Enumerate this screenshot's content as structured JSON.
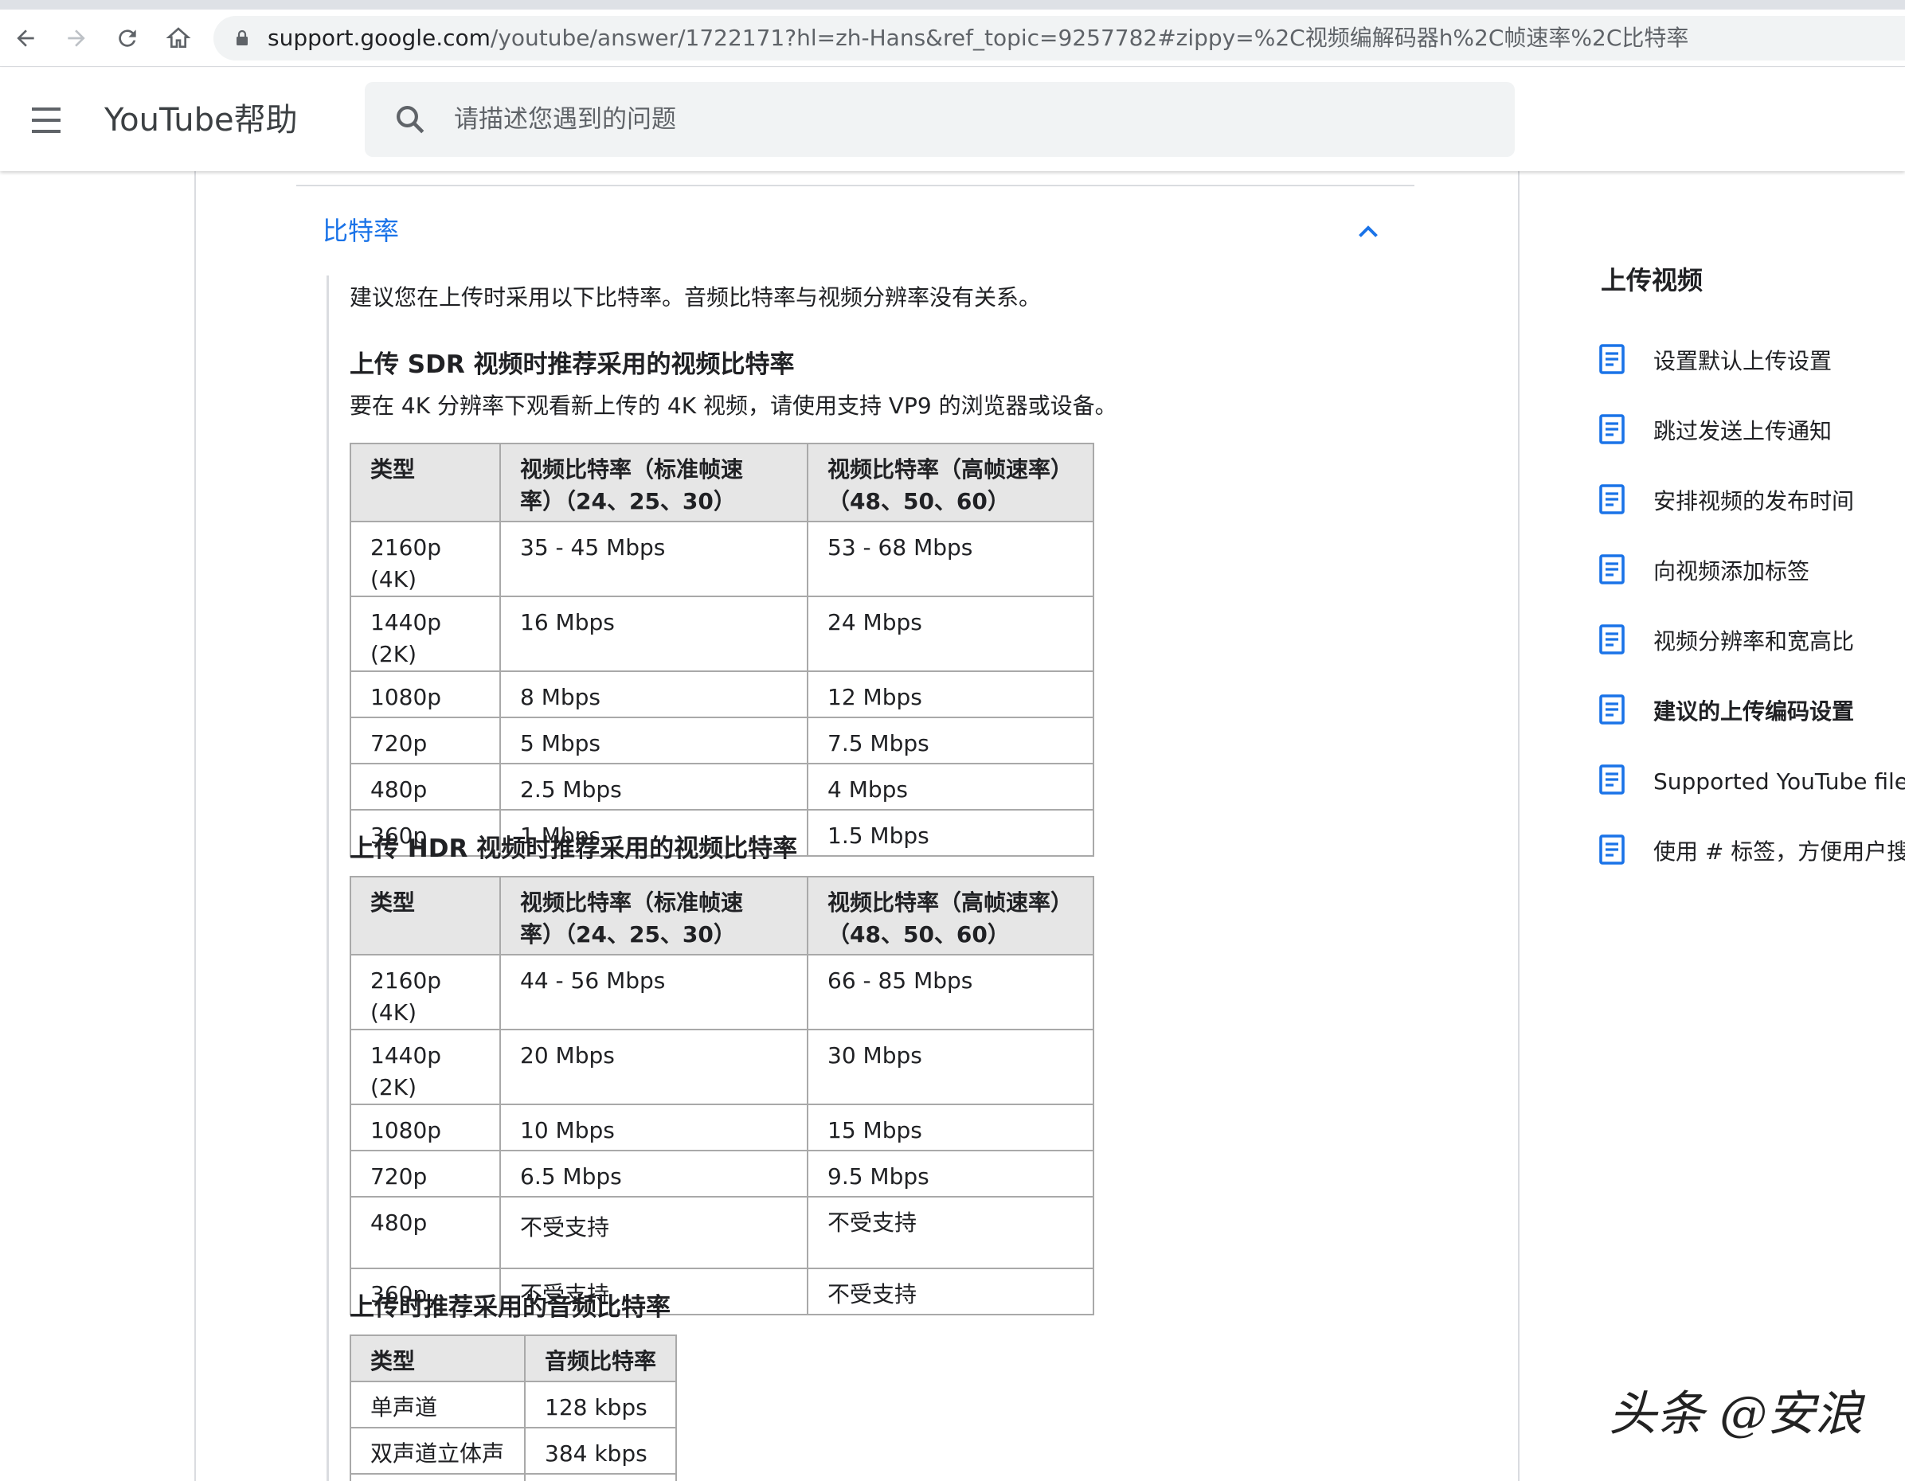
{
  "browser": {
    "url_host": "support.google.com",
    "url_path": "/youtube/answer/1722171?hl=zh-Hans&ref_topic=9257782#zippy=%2C视频编解码器h%2C帧速率%2C比特率"
  },
  "header": {
    "title": "YouTube帮助",
    "search_placeholder": "请描述您遇到的问题"
  },
  "section": {
    "title": "比特率",
    "intro": "建议您在上传时采用以下比特率。音频比特率与视频分辨率没有关系。"
  },
  "sdr": {
    "heading": "上传 SDR 视频时推荐采用的视频比特率",
    "note": "要在 4K 分辨率下观看新上传的 4K 视频，请使用支持 VP9 的浏览器或设备。",
    "columns": [
      "类型",
      "视频比特率（标准帧速率）（24、25、30）",
      "视频比特率（高帧速率）（48、50、60）"
    ],
    "rows": [
      [
        "2160p (4K)",
        "35 - 45 Mbps",
        "53 - 68 Mbps"
      ],
      [
        "1440p (2K)",
        "16 Mbps",
        "24 Mbps"
      ],
      [
        "1080p",
        "8 Mbps",
        "12 Mbps"
      ],
      [
        "720p",
        "5 Mbps",
        "7.5 Mbps"
      ],
      [
        "480p",
        "2.5 Mbps",
        "4 Mbps"
      ],
      [
        "360p",
        "1 Mbps",
        "1.5 Mbps"
      ]
    ]
  },
  "hdr": {
    "heading": "上传 HDR 视频时推荐采用的视频比特率",
    "columns": [
      "类型",
      "视频比特率（标准帧速率）（24、25、30）",
      "视频比特率（高帧速率）（48、50、60）"
    ],
    "rows": [
      [
        "2160p (4K)",
        "44 - 56 Mbps",
        "66 - 85 Mbps"
      ],
      [
        "1440p (2K)",
        "20 Mbps",
        "30 Mbps"
      ],
      [
        "1080p",
        "10 Mbps",
        "15 Mbps"
      ],
      [
        "720p",
        "6.5 Mbps",
        "9.5 Mbps"
      ],
      [
        "480p",
        "不受支持",
        "不受支持"
      ],
      [
        "360p",
        "不受支持",
        "不受支持"
      ]
    ]
  },
  "audio": {
    "heading": "上传时推荐采用的音频比特率",
    "columns": [
      "类型",
      "音频比特率"
    ],
    "rows": [
      [
        "单声道",
        "128 kbps"
      ],
      [
        "双声道立体声",
        "384 kbps"
      ]
    ]
  },
  "sidebar": {
    "title": "上传视频",
    "items": [
      {
        "label": "设置默认上传设置",
        "icon": "document-icon"
      },
      {
        "label": "跳过发送上传通知",
        "icon": "document-icon"
      },
      {
        "label": "安排视频的发布时间",
        "icon": "document-icon"
      },
      {
        "label": "向视频添加标签",
        "icon": "document-icon"
      },
      {
        "label": "视频分辨率和宽高比",
        "icon": "document-icon"
      },
      {
        "label": "建议的上传编码设置",
        "icon": "document-icon",
        "active": true
      },
      {
        "label": "Supported YouTube file fo",
        "icon": "document-icon"
      },
      {
        "label": "使用 # 标签，方便用户搜",
        "icon": "document-icon"
      }
    ]
  },
  "watermark": "头条 @安浪",
  "colors": {
    "link_blue": "#1a73e8",
    "header_fill": "#e6e6e6",
    "border": "#a9a9a9"
  }
}
